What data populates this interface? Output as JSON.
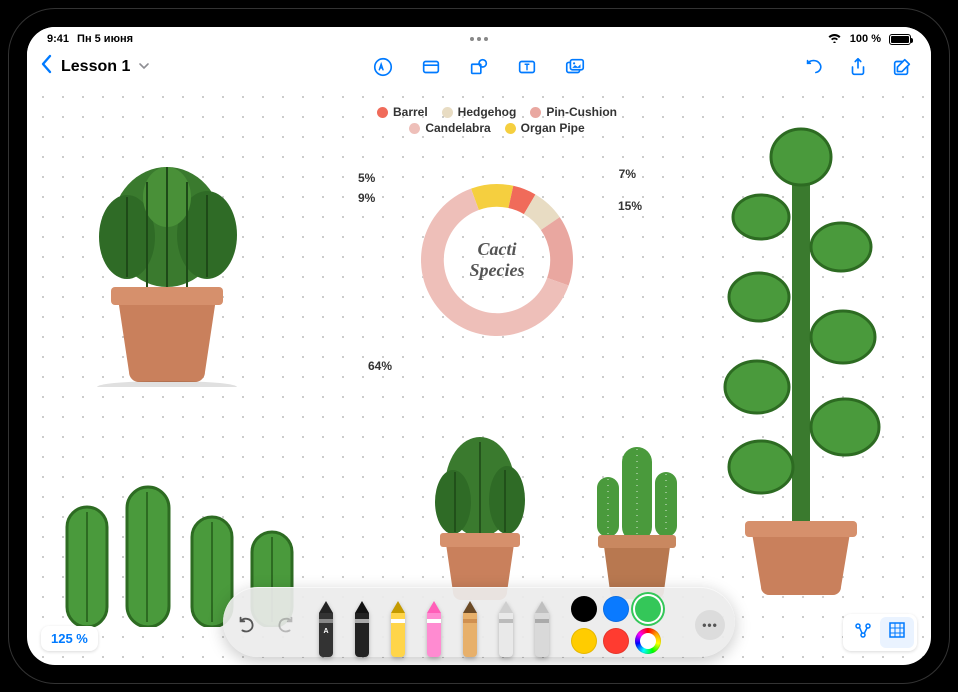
{
  "statusbar": {
    "time": "9:41",
    "date": "Пн 5 июня",
    "battery_text": "100 %",
    "wifi": true
  },
  "toolbar": {
    "back_label": "",
    "title": "Lesson 1",
    "icons": {
      "draw": "draw-icon",
      "note": "note-icon",
      "shape": "shape-icon",
      "text": "text-icon",
      "media": "media-icon",
      "undo": "undo-icon",
      "share": "share-icon",
      "compose": "compose-icon"
    }
  },
  "zoom": {
    "label": "125 %"
  },
  "view_toggle": {
    "mode_a": "graph",
    "mode_b": "grid"
  },
  "palette": {
    "undo": true,
    "redo": false,
    "tools": [
      "pen",
      "fountain",
      "marker",
      "highlighter",
      "pencil",
      "eraser",
      "ruler"
    ],
    "colors": [
      "#000000",
      "#0a7aff",
      "#34c759",
      "#ffcc00",
      "#ff3b30"
    ],
    "selected_color": "#34c759"
  },
  "chart_data": {
    "type": "pie",
    "title": "Cacti Species",
    "series": [
      {
        "name": "Barrel",
        "value": 5,
        "color": "#f06b5a"
      },
      {
        "name": "Hedgehog",
        "value": 7,
        "color": "#e8dcc3"
      },
      {
        "name": "Pin-Cushion",
        "value": 15,
        "color": "#e9a7a0"
      },
      {
        "name": "Candelabra",
        "value": 64,
        "color": "#eebfb9"
      },
      {
        "name": "Organ Pipe",
        "value": 9,
        "color": "#f5cf3f"
      }
    ],
    "labels": [
      "5%",
      "9%",
      "7%",
      "15%",
      "64%"
    ],
    "legend_order": [
      "Barrel",
      "Hedgehog",
      "Pin-Cushion",
      "Candelabra",
      "Organ Pipe"
    ]
  }
}
